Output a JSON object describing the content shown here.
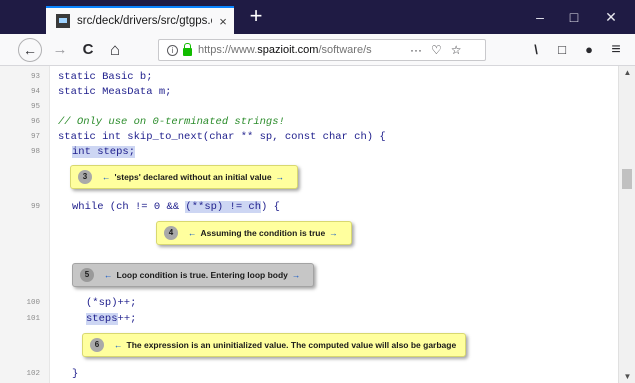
{
  "tab": {
    "title": "src/deck/drivers/src/gtgps.c",
    "close": "×"
  },
  "new_tab": "+",
  "window": {
    "minimize": "–",
    "maximize": "□",
    "close": "✕"
  },
  "nav": {
    "back": "←",
    "forward": "→",
    "reload": "C",
    "home": "⌂"
  },
  "url": {
    "prefix": "https://www.",
    "domain": "spazioit.com",
    "path": "/software/s"
  },
  "url_actions": {
    "more": "···",
    "pocket": "♡",
    "bookmark": "☆"
  },
  "toolbar": {
    "library": "\\",
    "sidebar": "□",
    "account": "●",
    "menu": "≡"
  },
  "lines": [
    {
      "no": "93",
      "code": "static Basic b;"
    },
    {
      "no": "94",
      "code": "static MeasData m;"
    },
    {
      "no": "95",
      "code": ""
    },
    {
      "no": "96",
      "code": "// Only use on 0-terminated strings!"
    },
    {
      "no": "97",
      "code": "static int skip_to_next(char ** sp, const char ch) {"
    },
    {
      "no": "98",
      "code": "int steps;"
    },
    {
      "no": "99",
      "code_a": "while (ch != 0 && ",
      "code_b": "(**sp) != ch",
      "code_c": ") {"
    },
    {
      "no": "100",
      "code": "(*sp)++;"
    },
    {
      "no": "101",
      "code_a": "steps",
      "code_b": "++;"
    },
    {
      "no": "102",
      "code": "}"
    }
  ],
  "notes": [
    {
      "num": "3",
      "text": "'steps' declared without an initial value"
    },
    {
      "num": "4",
      "text": "Assuming the condition is true"
    },
    {
      "num": "5",
      "text": "Loop condition is true.  Entering loop body"
    },
    {
      "num": "6",
      "text": "The expression is an uninitialized value. The computed value will also be garbage"
    }
  ],
  "scroll": {
    "up": "▲",
    "down": "▼"
  },
  "colors": {
    "note_yellow": "#ffff9e",
    "note_grey": "#c6c6c6",
    "code_blue": "#1e1e8c",
    "comment_green": "#2b8c2b",
    "highlight": "#cdd6f3"
  }
}
